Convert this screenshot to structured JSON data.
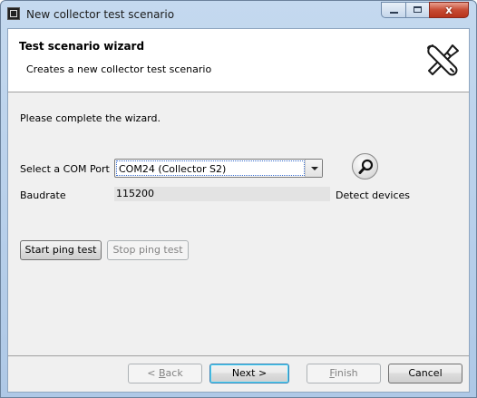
{
  "window": {
    "title": "New collector test scenario",
    "close_glyph": "x"
  },
  "header": {
    "title": "Test scenario wizard",
    "description": "Creates a new collector test scenario",
    "icon": "tools-icon"
  },
  "body": {
    "instruction": "Please complete the wizard.",
    "com_port": {
      "label": "Select a COM Port",
      "value": "COM24 (Collector S2)"
    },
    "detect": {
      "icon": "search-icon",
      "label": "Detect devices"
    },
    "baudrate": {
      "label": "Baudrate",
      "value": "115200"
    },
    "ping": {
      "start_label": "Start ping test",
      "stop_label": "Stop ping test",
      "stop_disabled": true
    }
  },
  "footer": {
    "back": {
      "prefix": "< ",
      "mnemonic": "B",
      "rest": "ack",
      "disabled": true
    },
    "next": {
      "label": "Next >"
    },
    "finish": {
      "mnemonic": "F",
      "rest": "inish",
      "disabled": true
    },
    "cancel": {
      "label": "Cancel"
    }
  },
  "colors": {
    "default_button_border": "#3c7fb1",
    "title_bar": "#c4d9ef"
  }
}
